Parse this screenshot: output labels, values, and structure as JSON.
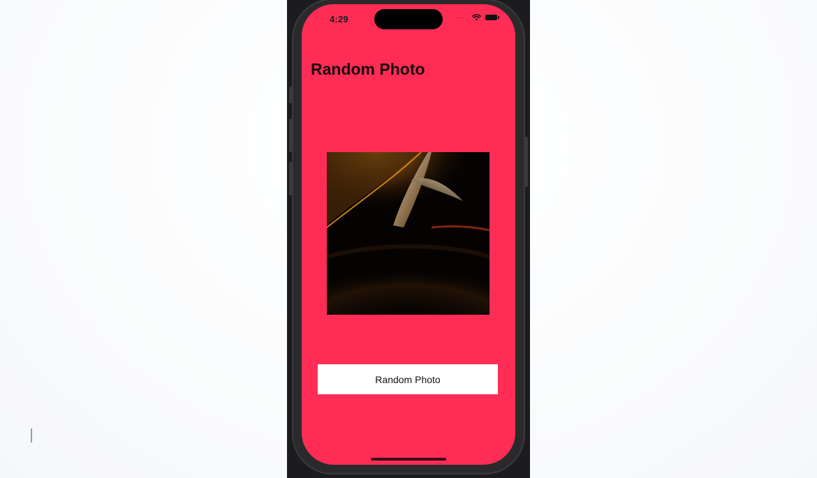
{
  "status_bar": {
    "time": "4:29",
    "signal_icon": "signal-dots-icon",
    "wifi_icon": "wifi-icon",
    "battery_icon": "battery-icon"
  },
  "main": {
    "title": "Random Photo",
    "photo": {
      "description_icon": "abstract-dark-wallpaper-image"
    },
    "button_label": "Random Photo"
  },
  "colors": {
    "screen_background": "#ff2d55",
    "button_background": "#ffffff",
    "device_frame": "#1c1c1e"
  }
}
